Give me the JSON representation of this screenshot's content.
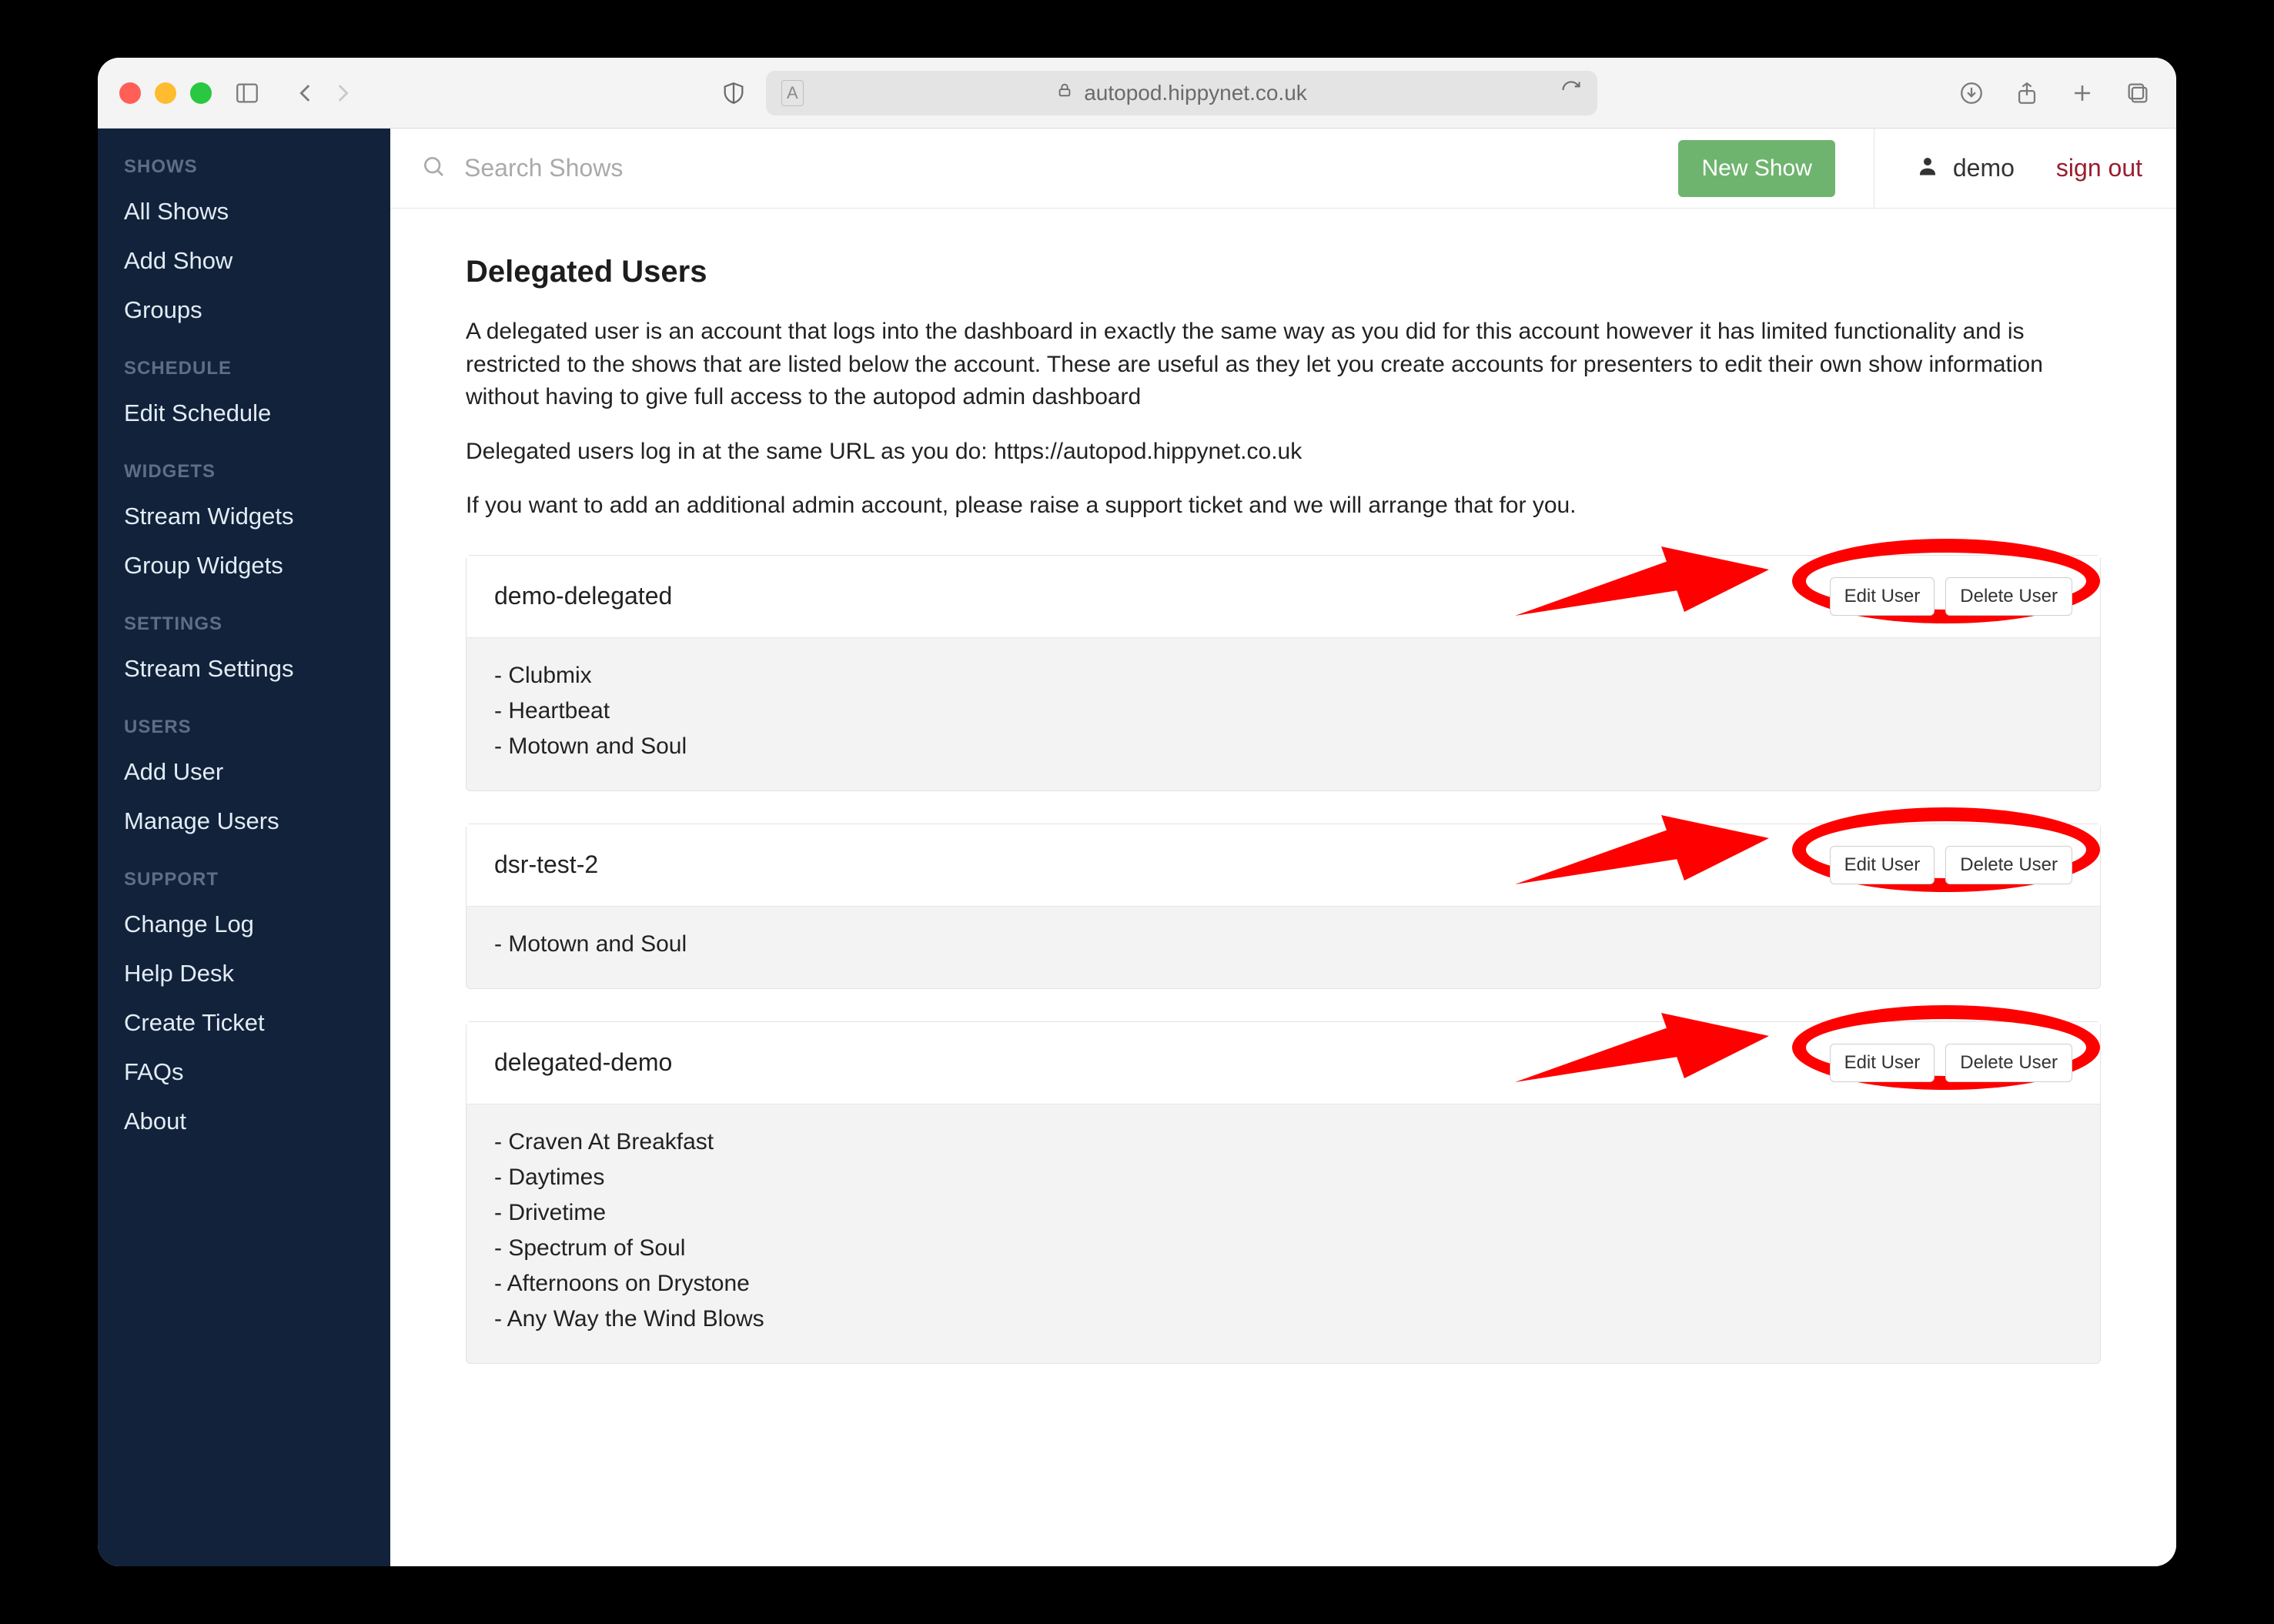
{
  "browser": {
    "address": "autopod.hippynet.co.uk"
  },
  "sidebar": {
    "sections": [
      {
        "heading": "SHOWS",
        "items": [
          "All Shows",
          "Add Show",
          "Groups"
        ]
      },
      {
        "heading": "SCHEDULE",
        "items": [
          "Edit Schedule"
        ]
      },
      {
        "heading": "WIDGETS",
        "items": [
          "Stream Widgets",
          "Group Widgets"
        ]
      },
      {
        "heading": "SETTINGS",
        "items": [
          "Stream Settings"
        ]
      },
      {
        "heading": "USERS",
        "items": [
          "Add User",
          "Manage Users"
        ]
      },
      {
        "heading": "SUPPORT",
        "items": [
          "Change Log",
          "Help Desk",
          "Create Ticket",
          "FAQs",
          "About"
        ]
      }
    ]
  },
  "topbar": {
    "search_placeholder": "Search Shows",
    "new_show_label": "New Show",
    "username": "demo",
    "signout_label": "sign out"
  },
  "page": {
    "title": "Delegated Users",
    "para1": "A delegated user is an account that logs into the dashboard in exactly the same way as you did for this account however it has limited functionality and is restricted to the shows that are listed below the account. These are useful as they let you create accounts for presenters to edit their own show information without having to give full access to the autopod admin dashboard",
    "para2": "Delegated users log in at the same URL as you do: https://autopod.hippynet.co.uk",
    "para3": "If you want to add an additional admin account, please raise a support ticket and we will arrange that for you."
  },
  "buttons": {
    "edit_user": "Edit User",
    "delete_user": "Delete User"
  },
  "users": [
    {
      "name": "demo-delegated",
      "shows": [
        "Clubmix",
        "Heartbeat",
        "Motown and Soul"
      ]
    },
    {
      "name": "dsr-test-2",
      "shows": [
        "Motown and Soul"
      ]
    },
    {
      "name": "delegated-demo",
      "shows": [
        "Craven At Breakfast",
        "Daytimes",
        "Drivetime",
        "Spectrum of Soul",
        "Afternoons on Drystone",
        "Any Way the Wind Blows"
      ]
    }
  ]
}
